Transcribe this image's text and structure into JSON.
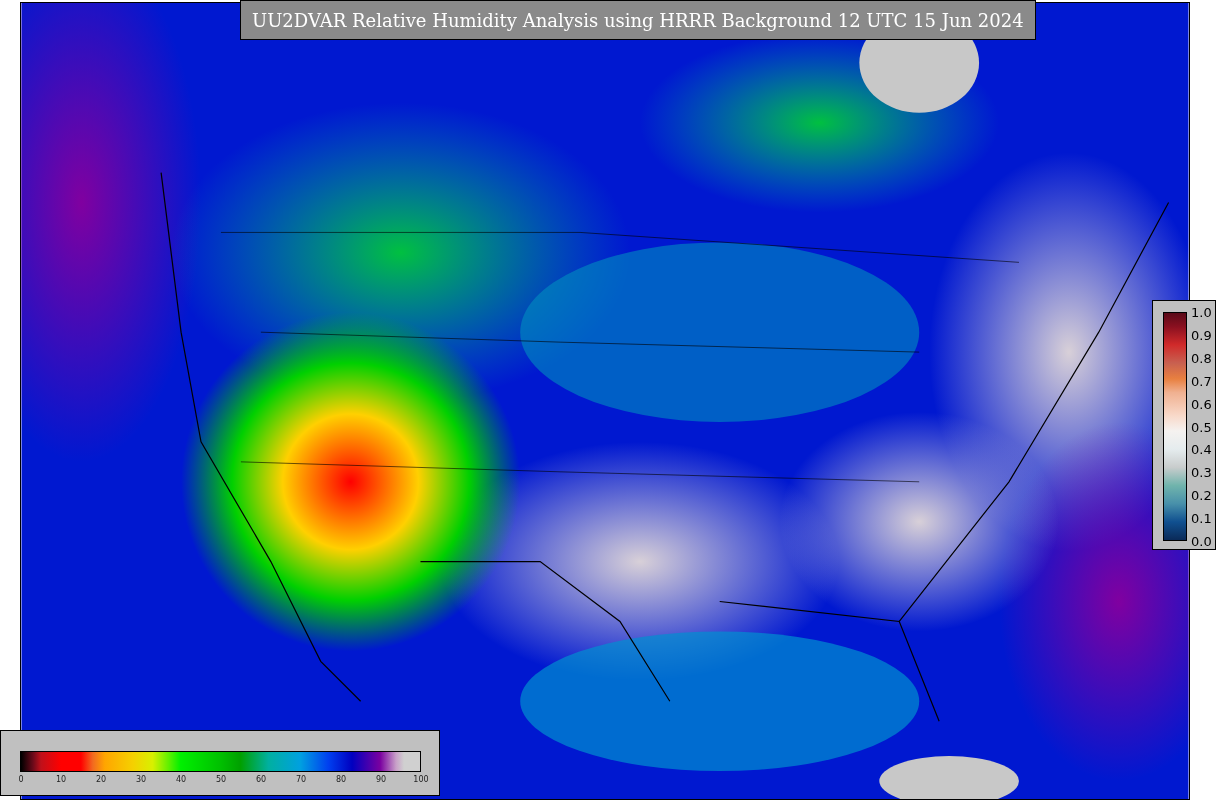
{
  "title": "UU2DVAR Relative Humidity Analysis using HRRR Background 12 UTC 15 Jun 2024",
  "humidity_colorbar": {
    "ticks": [
      "0",
      "10",
      "20",
      "30",
      "40",
      "50",
      "60",
      "70",
      "80",
      "90",
      "100"
    ]
  },
  "ratio_colorbar": {
    "ticks": [
      "1.0",
      "0.9",
      "0.8",
      "0.7",
      "0.6",
      "0.5",
      "0.4",
      "0.3",
      "0.2",
      "0.1",
      "0.0"
    ]
  }
}
